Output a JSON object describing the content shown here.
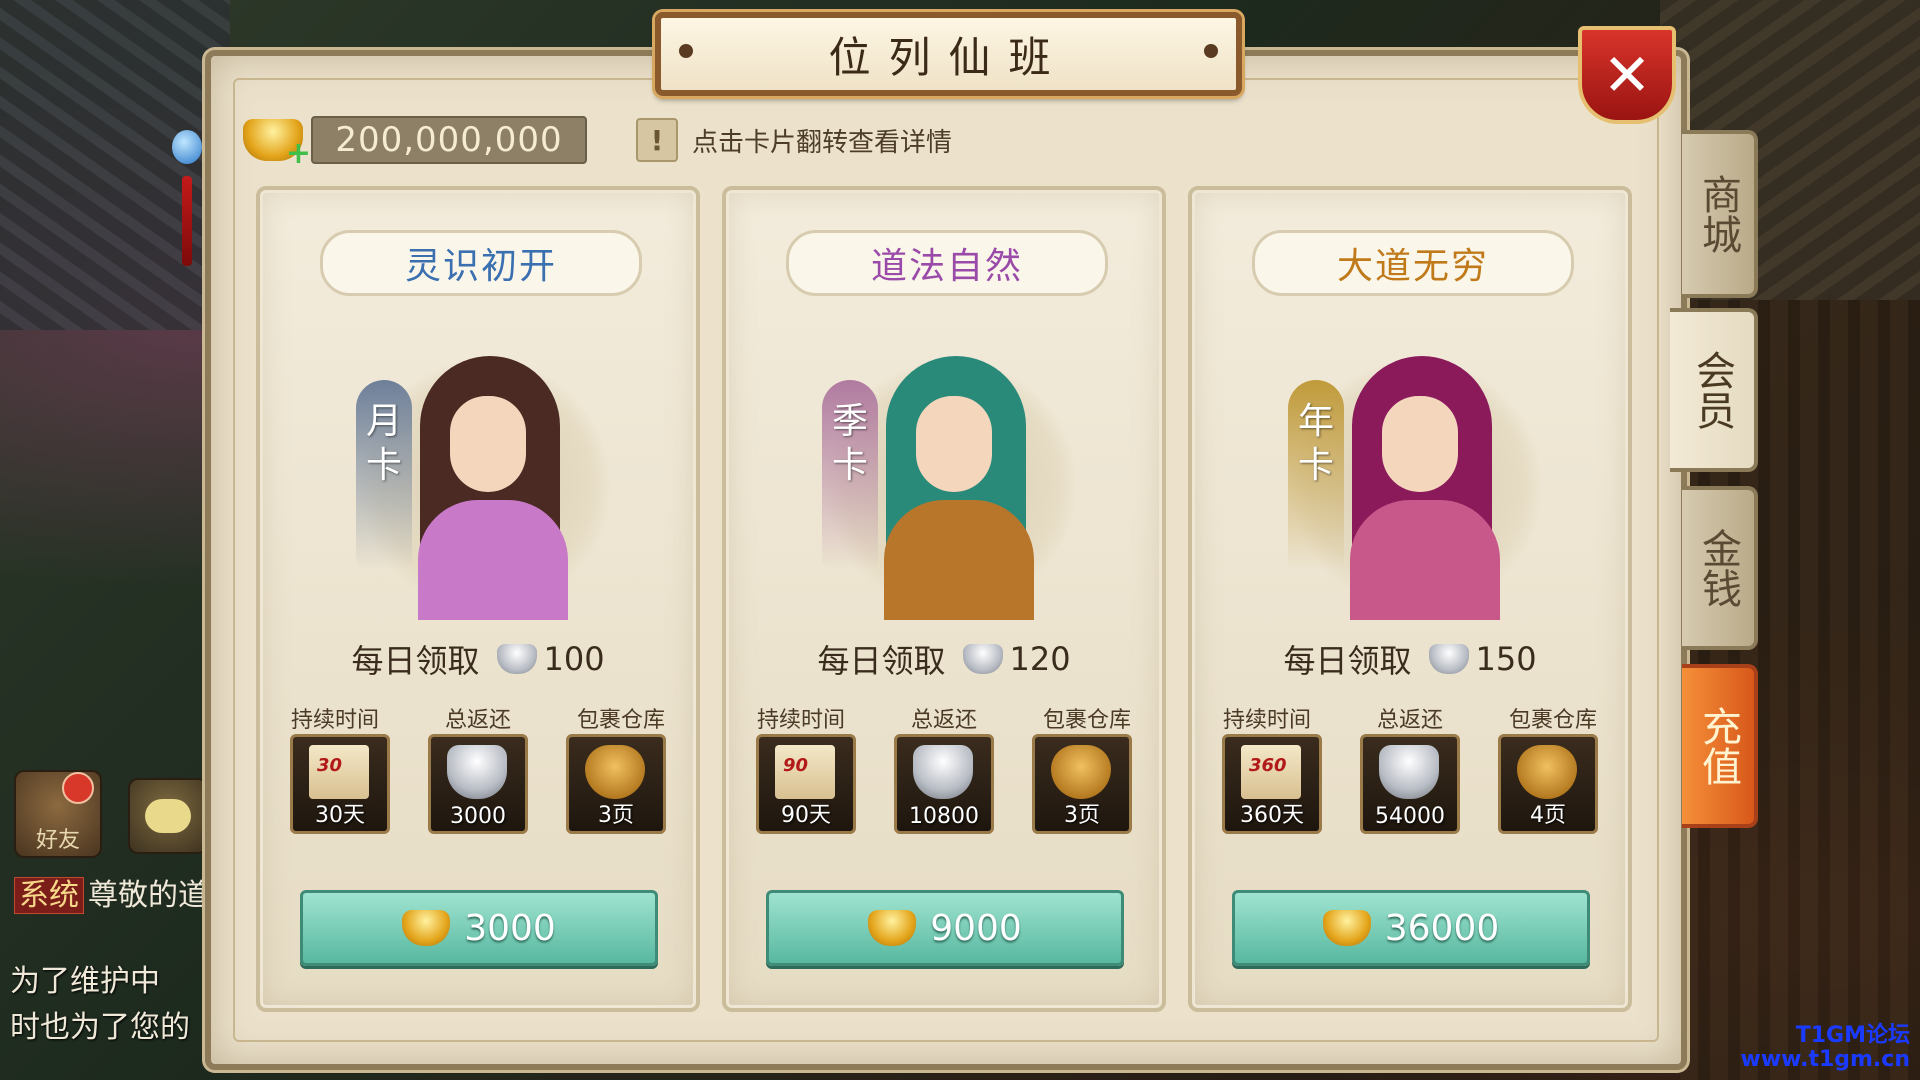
{
  "title": "位列仙班",
  "currency": {
    "amount": "200,000,000",
    "icon": "gold-ingot-plus-icon"
  },
  "hint": {
    "icon": "exclamation-icon",
    "text": "点击卡片翻转查看详情"
  },
  "close": {
    "label": "✕",
    "icon": "close-icon"
  },
  "cards": [
    {
      "title": "灵识初开",
      "title_color": "#3a6fb0",
      "ribbon": [
        "月",
        "卡"
      ],
      "ribbon_color": "#6d7f99",
      "hair_color": "#4a2a22",
      "dress_color": "#c87ac8",
      "daily_label": "每日领取",
      "daily_amount": "100",
      "stat_labels": [
        "持续时间",
        "总返还",
        "包裹仓库"
      ],
      "duration": "30天",
      "duration_num": "30",
      "total_return": "3000",
      "storage": "3页",
      "price": "3000"
    },
    {
      "title": "道法自然",
      "title_color": "#9a4aa8",
      "ribbon": [
        "季",
        "卡"
      ],
      "ribbon_color": "#b07aa0",
      "hair_color": "#2a8a7a",
      "dress_color": "#b8762a",
      "daily_label": "每日领取",
      "daily_amount": "120",
      "stat_labels": [
        "持续时间",
        "总返还",
        "包裹仓库"
      ],
      "duration": "90天",
      "duration_num": "90",
      "total_return": "10800",
      "storage": "3页",
      "price": "9000"
    },
    {
      "title": "大道无穷",
      "title_color": "#c07a1a",
      "ribbon": [
        "年",
        "卡"
      ],
      "ribbon_color": "#c09a3a",
      "hair_color": "#8a1a5a",
      "dress_color": "#c8588a",
      "daily_label": "每日领取",
      "daily_amount": "150",
      "stat_labels": [
        "持续时间",
        "总返还",
        "包裹仓库"
      ],
      "duration": "360天",
      "duration_num": "360",
      "total_return": "54000",
      "storage": "4页",
      "price": "36000"
    }
  ],
  "tabs": [
    {
      "label": "商城",
      "state": "normal"
    },
    {
      "label": "会员",
      "state": "active"
    },
    {
      "label": "金钱",
      "state": "normal"
    },
    {
      "label": "充值",
      "state": "charge"
    }
  ],
  "background": {
    "friend_label": "好友",
    "system_tag": "系统",
    "system_text": "尊敬的道",
    "chat_line1": "为了维护中",
    "chat_line2": "时也为了您的",
    "watermark_line1": "T1GM论坛",
    "watermark_line2": "www.t1gm.cn"
  }
}
